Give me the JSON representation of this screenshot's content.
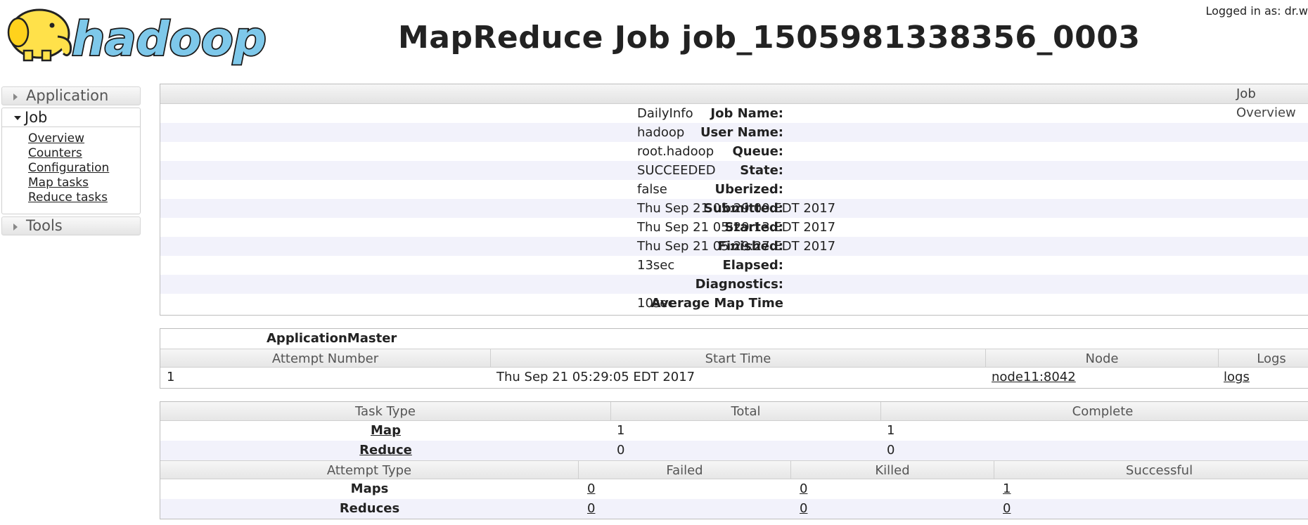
{
  "header": {
    "logo_text": "hadoop",
    "title": "MapReduce Job job_1505981338356_0003",
    "logged_in": "Logged in as: dr.w"
  },
  "sidebar": {
    "application_label": "Application",
    "job_label": "Job",
    "job_links": [
      "Overview",
      "Counters",
      "Configuration",
      "Map tasks",
      "Reduce tasks"
    ],
    "tools_label": "Tools"
  },
  "overview": {
    "header": "Job Overview",
    "rows": [
      {
        "label": "Job Name:",
        "value": "DailyInfo"
      },
      {
        "label": "User Name:",
        "value": "hadoop"
      },
      {
        "label": "Queue:",
        "value": "root.hadoop"
      },
      {
        "label": "State:",
        "value": "SUCCEEDED"
      },
      {
        "label": "Uberized:",
        "value": "false"
      },
      {
        "label": "Submitted:",
        "value": "Thu Sep 21 05:29:00 EDT 2017"
      },
      {
        "label": "Started:",
        "value": "Thu Sep 21 05:29:13 EDT 2017"
      },
      {
        "label": "Finished:",
        "value": "Thu Sep 21 05:29:27 EDT 2017"
      },
      {
        "label": "Elapsed:",
        "value": "13sec"
      },
      {
        "label": "Diagnostics:",
        "value": ""
      },
      {
        "label": "Average Map Time",
        "value": "10sec"
      }
    ]
  },
  "application_master": {
    "title": "ApplicationMaster",
    "columns": [
      "Attempt Number",
      "Start Time",
      "Node",
      "Logs"
    ],
    "row": {
      "attempt": "1",
      "start_time": "Thu Sep 21 05:29:05 EDT 2017",
      "node": "node11:8042",
      "logs": "logs"
    }
  },
  "tasks": {
    "columns": [
      "Task Type",
      "Total",
      "Complete"
    ],
    "rows": [
      {
        "type": "Map",
        "total": "1",
        "complete": "1"
      },
      {
        "type": "Reduce",
        "total": "0",
        "complete": "0"
      }
    ],
    "attempt_columns": [
      "Attempt Type",
      "Failed",
      "Killed",
      "Successful"
    ],
    "attempt_rows": [
      {
        "type": "Maps",
        "failed": "0",
        "killed": "0",
        "successful": "1"
      },
      {
        "type": "Reduces",
        "failed": "0",
        "killed": "0",
        "successful": "0"
      }
    ]
  }
}
